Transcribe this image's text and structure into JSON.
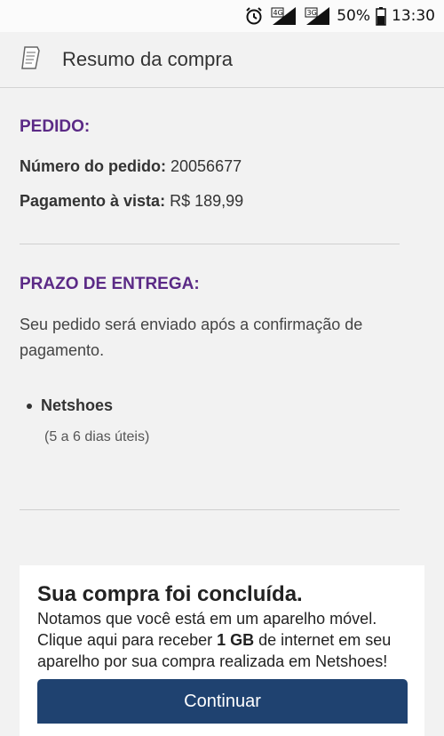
{
  "status_bar": {
    "network_1": "4G",
    "network_2": "3G",
    "battery": "50%",
    "time": "13:30",
    "icons": [
      "alarm-icon",
      "signal-4g-icon",
      "signal-3g-icon",
      "battery-icon"
    ]
  },
  "header": {
    "icon": "receipt-icon",
    "title": "Resumo da compra"
  },
  "pedido": {
    "section_title": "PEDIDO:",
    "order_number_label": "Número do pedido:",
    "order_number_value": "20056677",
    "payment_label": "Pagamento à vista:",
    "payment_value": "R$ 189,99"
  },
  "entrega": {
    "section_title": "PRAZO DE ENTREGA:",
    "description": "Seu pedido será enviado após a confirmação de pagamento.",
    "store_name": "Netshoes",
    "store_days": "(5 a 6 dias úteis)"
  },
  "card": {
    "title": "Sua compra foi concluída.",
    "text_1": "Notamos que você está em um aparelho móvel. Clique aqui para receber ",
    "text_bold": "1 GB",
    "text_2": " de internet em seu aparelho por sua compra realizada em Netshoes!",
    "button_label": "Continuar"
  },
  "colors": {
    "accent_purple": "#5b2a86",
    "button_blue": "#1f4270"
  }
}
